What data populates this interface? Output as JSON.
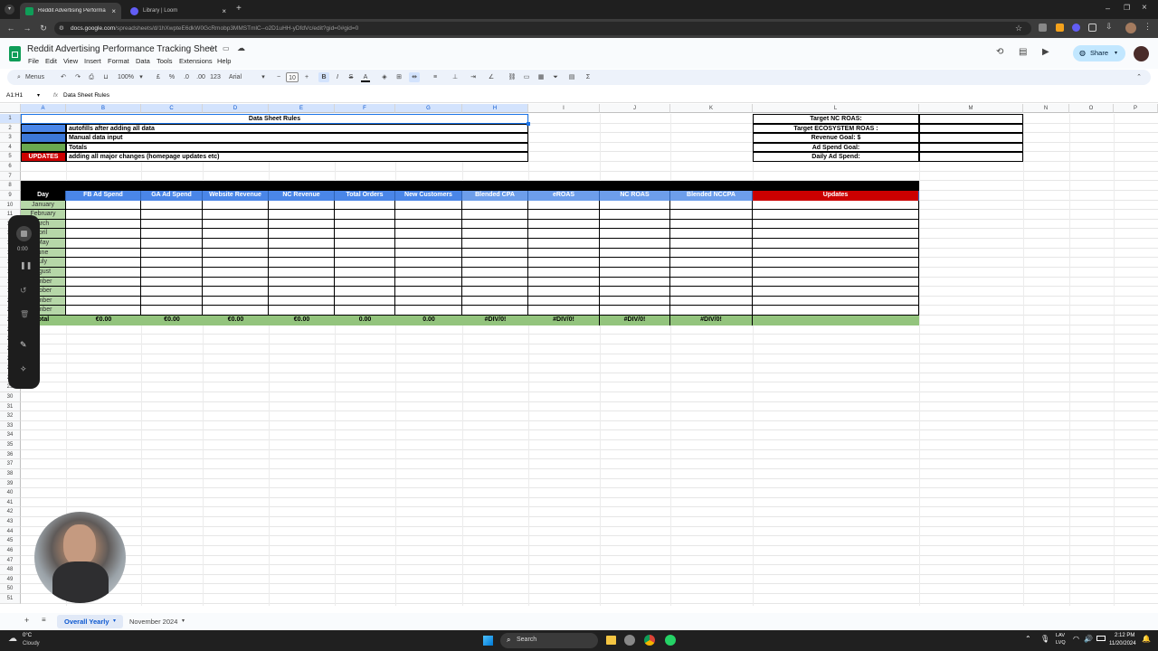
{
  "browser": {
    "tabs": [
      {
        "label": "Reddit Advertising Performance",
        "active": true
      },
      {
        "label": "Library | Loom",
        "active": false
      }
    ],
    "url": "docs.google.com",
    "url_rest": "/spreadsheets/d/1hXwpteE6dkW0GcRmobp3MMSTmlC--o2D1uHH-yDfdVc/edit?gid=0#gid=0"
  },
  "doc": {
    "title": "Reddit Advertising Performance Tracking Sheet",
    "menus": [
      "File",
      "Edit",
      "View",
      "Insert",
      "Format",
      "Data",
      "Tools",
      "Extensions",
      "Help"
    ],
    "share": "Share"
  },
  "toolbar": {
    "search": "Menus",
    "zoom": "100%",
    "currency": "£",
    "percent": "%",
    "dec_less": ".0",
    "dec_more": ".00",
    "numfmt": "123",
    "font": "Arial",
    "size": "10",
    "bold": "B",
    "italic": "I",
    "strike": "S",
    "textcolor": "A"
  },
  "formula": {
    "namebox": "A1:H1",
    "fx": "fx",
    "content": "Data Sheet Rules"
  },
  "columns": [
    "A",
    "B",
    "C",
    "D",
    "E",
    "F",
    "G",
    "H",
    "I",
    "J",
    "K",
    "L",
    "M",
    "N",
    "O",
    "P"
  ],
  "rows": [
    "1",
    "2",
    "3",
    "4",
    "5",
    "6",
    "7",
    "8",
    "9",
    "10",
    "11",
    "12",
    "13",
    "14",
    "15",
    "16",
    "17",
    "18",
    "19",
    "20",
    "21",
    "22",
    "23",
    "24",
    "25",
    "26",
    "27",
    "28",
    "29",
    "30",
    "31",
    "32",
    "33",
    "34",
    "35",
    "36",
    "37",
    "38",
    "39",
    "40",
    "41",
    "42",
    "43",
    "44",
    "45",
    "46",
    "47",
    "48",
    "49",
    "50",
    "51"
  ],
  "rules": {
    "title": "Data Sheet Rules",
    "rows": [
      {
        "color": "#4a86e8",
        "label": "",
        "text": "autofills after adding all data"
      },
      {
        "color": "#3c78d8",
        "label": "",
        "text": "Manual data input"
      },
      {
        "color": "#6aa84f",
        "label": "",
        "text": "Totals"
      },
      {
        "color": "#cc0000",
        "label": "UPDATES",
        "text": "adding all major changes (homepage updates etc)"
      }
    ]
  },
  "targets": [
    "Target NC ROAS:",
    "Target ECOSYSTEM ROAS :",
    "Revenue Goal: $",
    "Ad Spend Goal:",
    "Daily Ad Spend:"
  ],
  "table": {
    "headers": [
      "Day",
      "FB Ad Spend",
      "GA Ad Spend",
      "Website Revenue",
      "NC Revenue",
      "Total Orders",
      "New Customers",
      "Blended CPA",
      "eROAS",
      "NC ROAS",
      "Blended NCCPA",
      "Updates"
    ],
    "months": [
      "January",
      "February",
      "March",
      "April",
      "May",
      "June",
      "July",
      "August",
      "September",
      "October",
      "November",
      "December"
    ],
    "months_shown": [
      "January",
      "February",
      "arch",
      "pril",
      "May",
      "une",
      "uly",
      "ugust",
      "ember",
      "ctober",
      "ember",
      "ember"
    ],
    "totals": [
      "otal",
      "€0.00",
      "€0.00",
      "€0.00",
      "€0.00",
      "0.00",
      "0.00",
      "#DIV/0!",
      "#DIV/0!",
      "#DIV/0!",
      "#DIV/0!",
      ""
    ]
  },
  "recorder": {
    "time": "0:00"
  },
  "sheets": [
    "Overall Yearly",
    "November 2024"
  ],
  "taskbar": {
    "temp": "0°C",
    "weather": "Cloudy",
    "search": "Search",
    "lang1": "LAV",
    "lang2": "LVQ",
    "time": "2:12 PM",
    "date": "11/20/2024"
  }
}
